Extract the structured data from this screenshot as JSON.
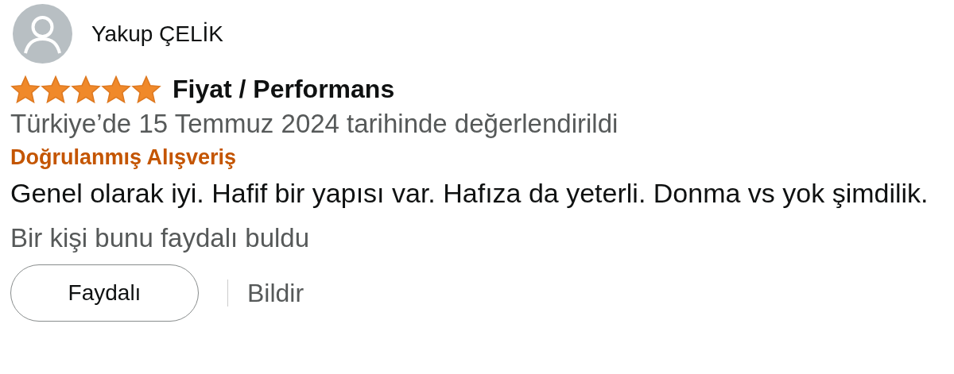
{
  "review": {
    "author": "Yakup ÇELİK",
    "stars": 5,
    "title": "Fiyat / Performans",
    "date_line": "Türkiye’de 15 Temmuz 2024 tarihinde değerlendirildi",
    "badge": "Doğrulanmış Alışveriş",
    "body": "Genel olarak iyi. Hafif bir yapısı var. Hafıza da yeterli. Donma vs yok şimdilik.",
    "helpful_count": "Bir kişi bunu faydalı buldu",
    "helpful_button": "Faydalı",
    "report_link": "Bildir"
  }
}
